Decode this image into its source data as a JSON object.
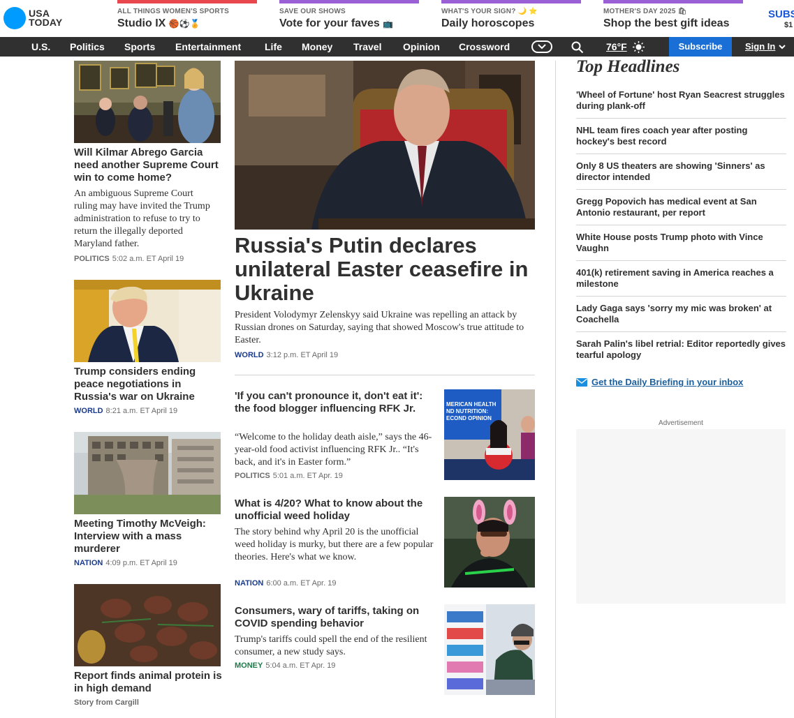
{
  "logo": {
    "line1": "USA",
    "line2": "TODAY"
  },
  "promos": [
    {
      "kicker": "ALL THINGS WOMEN'S SPORTS",
      "title": "Studio IX",
      "emoji": "🏀⚽🏅",
      "color": "#e9474e"
    },
    {
      "kicker": "SAVE OUR SHOWS",
      "title": "Vote for your faves",
      "emoji": "📺",
      "color": "#9b5fd6"
    },
    {
      "kicker": "WHAT'S YOUR SIGN? 🌙 ⭐",
      "title": "Daily horoscopes",
      "emoji": "",
      "color": "#9b5fd6"
    },
    {
      "kicker": "MOTHER'S DAY 2025 🛍",
      "title": "Shop the best gift ideas",
      "emoji": "",
      "color": "#9b5fd6"
    }
  ],
  "header_cut": {
    "label": "SUBS",
    "sub": "$1"
  },
  "nav": {
    "items": [
      "U.S.",
      "Politics",
      "Sports",
      "Entertainment",
      "Life",
      "Money",
      "Travel",
      "Opinion",
      "Crossword"
    ],
    "weather": "76°F",
    "subscribe": "Subscribe",
    "signin": "Sign In"
  },
  "left_stories": [
    {
      "headline": "Will Kilmar Abrego Garcia need another Supreme Court win to come home?",
      "dek": "An ambiguous Supreme Court ruling may have invited the Trump administration to refuse to try to return the illegally deported Maryland father.",
      "section": "POLITICS",
      "time": "5:02 a.m. ET April 19",
      "section_color": "#6a6a6a"
    },
    {
      "headline": "Trump considers ending peace negotiations in Russia's war on Ukraine",
      "dek": "",
      "section": "WORLD",
      "time": "8:21 a.m. ET April 19",
      "section_color": "#1a3a8a"
    },
    {
      "headline": "Meeting Timothy McVeigh: Interview with a mass murderer",
      "dek": "",
      "section": "NATION",
      "time": "4:09 p.m. ET April 19",
      "section_color": "#1a3a8a"
    },
    {
      "headline": "Report finds animal protein is in high demand",
      "dek": "",
      "section": "Story from Cargill",
      "time": "",
      "section_color": "#6a6a6a"
    }
  ],
  "lead": {
    "headline": "Russia's Putin declares unilateral Easter ceasefire in Ukraine",
    "dek": "President Volodymyr Zelenskyy said Ukraine was repelling an attack by Russian drones on Saturday, saying that showed Moscow's true attitude to Easter.",
    "section": "WORLD",
    "time": "3:12 p.m. ET April 19",
    "section_color": "#1a3a8a"
  },
  "mid_stories": [
    {
      "headline": "'If you can't pronounce it, don't eat it': the food blogger influencing RFK Jr.",
      "dek": "“Welcome to the holiday death aisle,” says the 46-year-old food activist influencing RFK Jr.. “It's back, and it's in Easter form.”",
      "section": "POLITICS",
      "time": "5:01 a.m. ET Apr. 19",
      "section_color": "#6a6a6a",
      "thumb_text": "AMERICAN HEALTH AND NUTRITION: SECOND OPINION"
    },
    {
      "headline": "What is 4/20? What to know about the unofficial weed holiday",
      "dek": "The story behind why April 20 is the unofficial weed holiday is murky, but there are a few popular theories. Here's what we know.",
      "section": "NATION",
      "time": "6:00 a.m. ET Apr. 19",
      "section_color": "#1a3a8a"
    },
    {
      "headline": "Consumers, wary of tariffs, taking on COVID spending behavior",
      "dek": "Trump's tariffs could spell the end of the resilient consumer, a new study says.",
      "section": "MONEY",
      "time": "5:04 a.m. ET Apr. 19",
      "section_color": "#1e7a4a"
    }
  ],
  "top_headlines": {
    "title": "Top Headlines",
    "items": [
      "'Wheel of Fortune' host Ryan Seacrest struggles during plank-off",
      "NHL team fires coach year after posting hockey's best record",
      "Only 8 US theaters are showing 'Sinners' as director intended",
      "Gregg Popovich has medical event at San Antonio restaurant, per report",
      "White House posts Trump photo with Vince Vaughn",
      "401(k) retirement saving in America reaches a milestone",
      "Lady Gaga says 'sorry my mic was broken' at Coachella",
      "Sarah Palin's libel retrial: Editor reportedly gives tearful apology"
    ],
    "briefing": "Get the Daily Briefing in your inbox"
  },
  "advertisement_label": "Advertisement",
  "colors": {
    "brand": "#009bff",
    "nav_bg": "#303030",
    "subscribe_bg": "#1a6fd6",
    "headline_highlight": "#bfe1fb"
  }
}
